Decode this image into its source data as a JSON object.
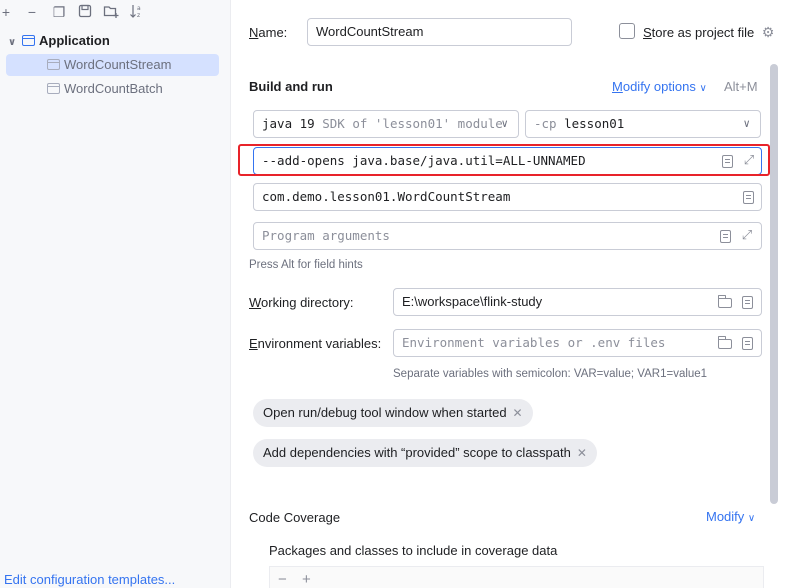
{
  "toolbar": {
    "icons": [
      "plus-icon",
      "minus-icon",
      "copy-icon",
      "save-icon",
      "new-folder-icon",
      "sort-icon"
    ]
  },
  "tree": {
    "group_label": "Application",
    "items": [
      {
        "label": "WordCountStream",
        "selected": true
      },
      {
        "label": "WordCountBatch",
        "selected": false
      }
    ]
  },
  "footer": {
    "edit_templates": "Edit configuration templates..."
  },
  "form": {
    "name_label_prefix": "N",
    "name_label_rest": "ame:",
    "name_value": "WordCountStream",
    "store_label_prefix": "S",
    "store_label_rest": "tore as project file",
    "build_run_title": "Build and run",
    "modify_options_prefix": "M",
    "modify_options_rest": "odify options",
    "modify_shortcut": "Alt+M",
    "sdk_main": "java 19",
    "sdk_detail": "SDK of 'lesson01' module",
    "cp_flag": "-cp",
    "cp_value": "lesson01",
    "vm_options": "--add-opens java.base/java.util=ALL-UNNAMED",
    "main_class": "com.demo.lesson01.WordCountStream",
    "program_args_placeholder": "Program arguments",
    "field_hint": "Press Alt for field hints",
    "working_dir_label_prefix": "W",
    "working_dir_label_rest": "orking directory:",
    "working_dir_value": "E:\\workspace\\flink-study",
    "env_label_prefix": "E",
    "env_label_rest": "nvironment variables:",
    "env_placeholder": "Environment variables or .env files",
    "env_hint": "Separate variables with semicolon: VAR=value; VAR1=value1",
    "chips": [
      "Open run/debug tool window when started",
      "Add dependencies with “provided” scope to classpath"
    ],
    "code_coverage_title": "Code Coverage",
    "coverage_modify": "Modify",
    "coverage_packages_label": "Packages and classes to include in coverage data"
  },
  "colors": {
    "accent": "#3574f0",
    "highlight": "#e8232a",
    "selection": "#d5e1ff"
  }
}
